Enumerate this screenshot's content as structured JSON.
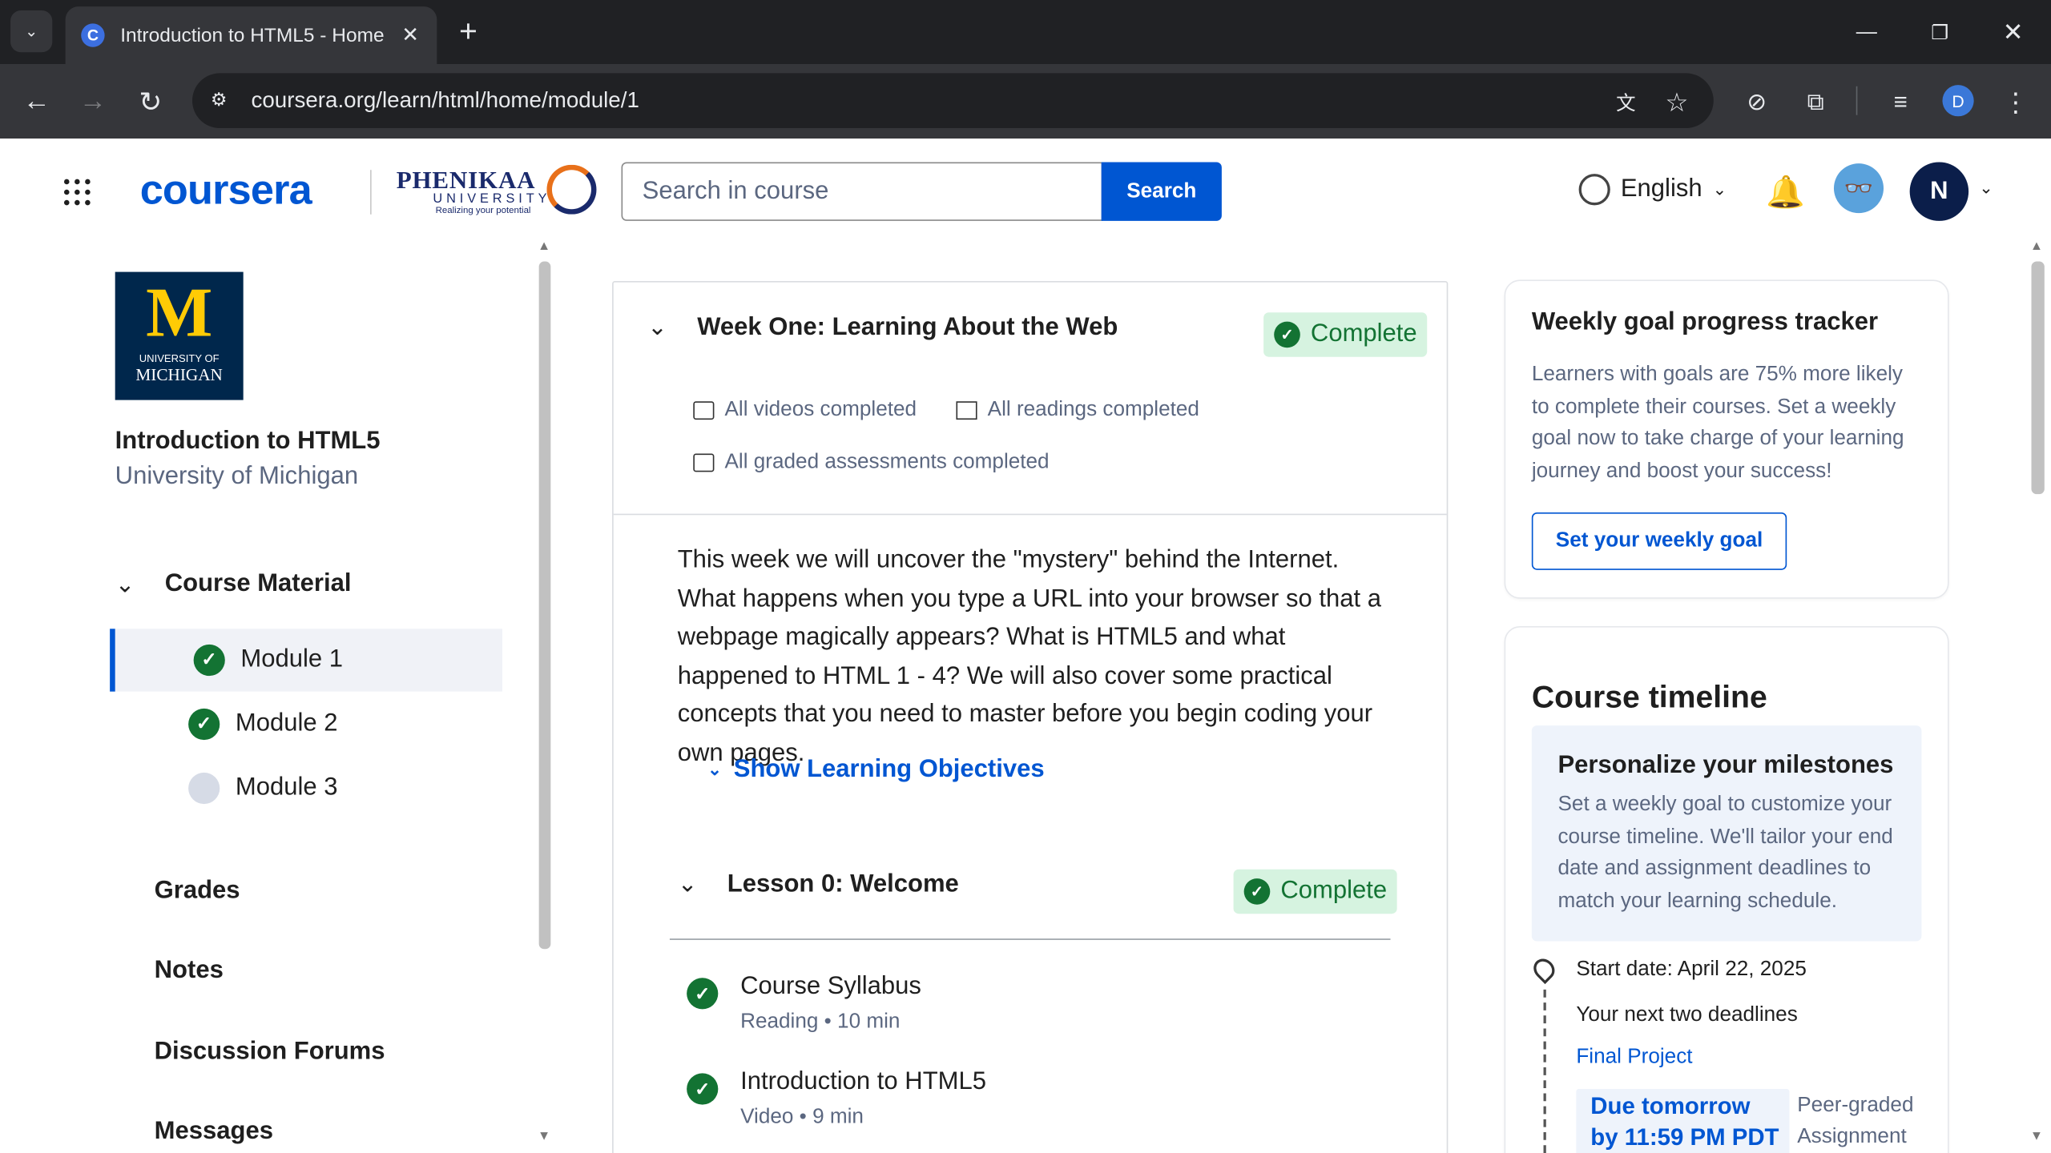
{
  "browser": {
    "tab_title": "Introduction to HTML5 - Home",
    "new_tab": "+",
    "url": "coursera.org/learn/html/home/module/1",
    "profile_initial": "D"
  },
  "header": {
    "brand": "coursera",
    "partner_name": "PHENIKAA",
    "partner_sub": "UNIVERSITY",
    "partner_tagline": "Realizing your potential",
    "search_placeholder": "Search in course",
    "search_button": "Search",
    "language": "English",
    "avatar_initial": "N"
  },
  "sidebar": {
    "university_logo_m": "M",
    "university_logo_text": "UNIVERSITY OF",
    "university_logo_text2": "MICHIGAN",
    "course_title": "Introduction to HTML5",
    "university": "University of Michigan",
    "course_material": "Course Material",
    "modules": [
      {
        "label": "Module 1",
        "status": "complete",
        "active": true
      },
      {
        "label": "Module 2",
        "status": "complete",
        "active": false
      },
      {
        "label": "Module 3",
        "status": "pending",
        "active": false
      }
    ],
    "links": [
      "Grades",
      "Notes",
      "Discussion Forums",
      "Messages"
    ]
  },
  "week": {
    "title": "Week One: Learning About the Web",
    "status": "Complete",
    "videos": "All videos completed",
    "readings": "All readings completed",
    "assessments": "All graded assessments completed",
    "description": "This week we will uncover the \"mystery\" behind the Internet. What happens when you type a URL into your browser so that a webpage magically appears? What is HTML5 and what happened to HTML 1 - 4? We will also cover some practical concepts that you need to master before you begin coding your own pages.",
    "objectives_link": "Show Learning Objectives"
  },
  "lesson": {
    "title": "Lesson 0: Welcome",
    "status": "Complete",
    "items": [
      {
        "title": "Course Syllabus",
        "meta": "Reading • 10 min"
      },
      {
        "title": "Introduction to HTML5",
        "meta": "Video • 9 min"
      }
    ]
  },
  "goal_tracker": {
    "title": "Weekly goal progress tracker",
    "text": "Learners with goals are 75% more likely to complete their courses. Set a weekly goal now to take charge of your learning journey and boost your success!",
    "button": "Set your weekly goal"
  },
  "timeline": {
    "title": "Course timeline",
    "personalize_title": "Personalize your milestones",
    "personalize_text": "Set a weekly goal to customize your course timeline. We'll tailor your end date and assignment deadlines to match your learning schedule.",
    "start_date": "Start date: April 22, 2025",
    "next_deadlines": "Your next two deadlines",
    "project_link": "Final Project",
    "due_line1": "Due tomorrow",
    "due_line2": "by 11:59 PM PDT",
    "type_line1": "Peer-graded",
    "type_line2": "Assignment"
  },
  "colors": {
    "brand": "#0056d2",
    "complete": "#137333",
    "complete_bg": "#d6f3e0"
  }
}
